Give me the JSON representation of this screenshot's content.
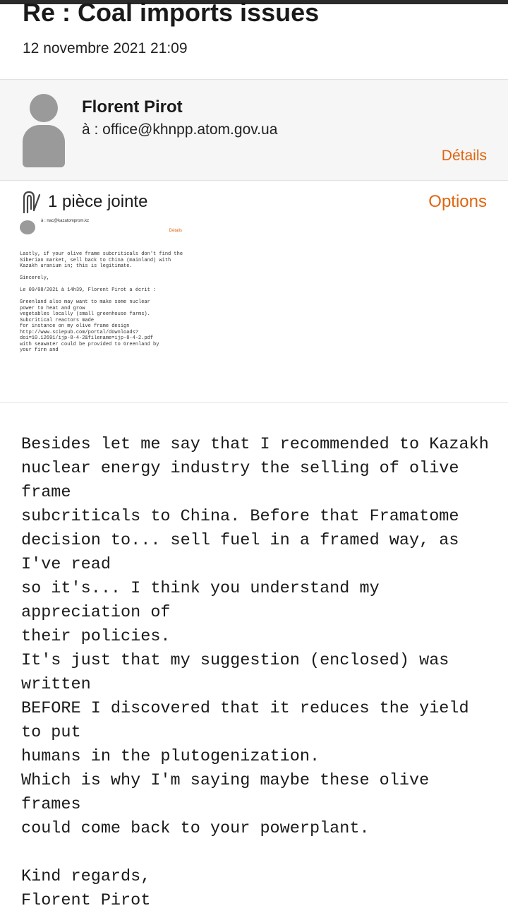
{
  "email": {
    "subject": "Re : Coal imports issues",
    "date": "12 novembre 2021 21:09"
  },
  "sender": {
    "name": "Florent Pirot",
    "recipient": "à : office@khnpp.atom.gov.ua",
    "details_label": "Détails",
    "avatar_icon": "person-avatar-icon"
  },
  "attachments": {
    "count_label": "1 pièce jointe",
    "options_label": "Options",
    "icon": "paperclip-icon",
    "preview": {
      "to_line": "à : nac@kazatomprom.kz",
      "details_label": "Détails",
      "text": "Lastly, if your olive frame subcriticals don't find the\nSiberian market, sell back to China (mainland) with\nKazakh uranium in; this is legitimate.\n\nSincerely,\n\nLe 09/08/2021 à 14h39, Florent Pirot a écrit :\n\nGreenland also may want to make some nuclear\npower to heat and grow\nvegetables locally (small greenhouse farms).\nSubcritical reactors made\nfor instance on my olive frame design\nhttp://www.sciepub.com/portal/downloads?\ndoi=10.12691/ijp-8-4-2&filename=ijp-8-4-2.pdf\nwith seawater could be provided to Greenland by\nyour firm and"
    }
  },
  "message": {
    "body": "Besides let me say that I recommended to Kazakh\nnuclear energy industry the selling of olive frame\nsubcriticals to China. Before that Framatome\ndecision to... sell fuel in a framed way, as I've read\nso it's... I think you understand my appreciation of\ntheir policies.\nIt's just that my suggestion (enclosed) was written\nBEFORE I discovered that it reduces the yield to put\nhumans in the plutogenization.\nWhich is why I'm saying maybe these olive frames\ncould come back to your powerplant.\n\nKind regards,\nFlorent Pirot"
  },
  "colors": {
    "accent": "#e0650f",
    "panel_background": "#f6f6f6",
    "avatar": "#9a9a9a"
  }
}
